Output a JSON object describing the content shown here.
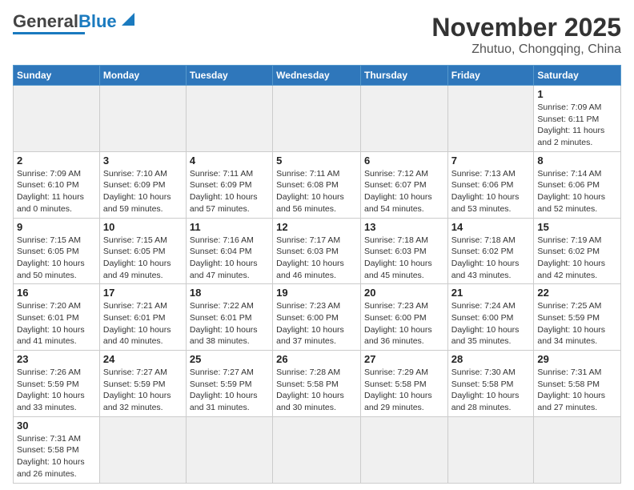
{
  "logo": {
    "text_general": "General",
    "text_blue": "Blue"
  },
  "title": {
    "month_year": "November 2025",
    "location": "Zhutuo, Chongqing, China"
  },
  "weekdays": [
    "Sunday",
    "Monday",
    "Tuesday",
    "Wednesday",
    "Thursday",
    "Friday",
    "Saturday"
  ],
  "weeks": [
    [
      {
        "day": "",
        "info": ""
      },
      {
        "day": "",
        "info": ""
      },
      {
        "day": "",
        "info": ""
      },
      {
        "day": "",
        "info": ""
      },
      {
        "day": "",
        "info": ""
      },
      {
        "day": "",
        "info": ""
      },
      {
        "day": "1",
        "info": "Sunrise: 7:09 AM\nSunset: 6:11 PM\nDaylight: 11 hours\nand 2 minutes."
      }
    ],
    [
      {
        "day": "2",
        "info": "Sunrise: 7:09 AM\nSunset: 6:10 PM\nDaylight: 11 hours\nand 0 minutes."
      },
      {
        "day": "3",
        "info": "Sunrise: 7:10 AM\nSunset: 6:09 PM\nDaylight: 10 hours\nand 59 minutes."
      },
      {
        "day": "4",
        "info": "Sunrise: 7:11 AM\nSunset: 6:09 PM\nDaylight: 10 hours\nand 57 minutes."
      },
      {
        "day": "5",
        "info": "Sunrise: 7:11 AM\nSunset: 6:08 PM\nDaylight: 10 hours\nand 56 minutes."
      },
      {
        "day": "6",
        "info": "Sunrise: 7:12 AM\nSunset: 6:07 PM\nDaylight: 10 hours\nand 54 minutes."
      },
      {
        "day": "7",
        "info": "Sunrise: 7:13 AM\nSunset: 6:06 PM\nDaylight: 10 hours\nand 53 minutes."
      },
      {
        "day": "8",
        "info": "Sunrise: 7:14 AM\nSunset: 6:06 PM\nDaylight: 10 hours\nand 52 minutes."
      }
    ],
    [
      {
        "day": "9",
        "info": "Sunrise: 7:15 AM\nSunset: 6:05 PM\nDaylight: 10 hours\nand 50 minutes."
      },
      {
        "day": "10",
        "info": "Sunrise: 7:15 AM\nSunset: 6:05 PM\nDaylight: 10 hours\nand 49 minutes."
      },
      {
        "day": "11",
        "info": "Sunrise: 7:16 AM\nSunset: 6:04 PM\nDaylight: 10 hours\nand 47 minutes."
      },
      {
        "day": "12",
        "info": "Sunrise: 7:17 AM\nSunset: 6:03 PM\nDaylight: 10 hours\nand 46 minutes."
      },
      {
        "day": "13",
        "info": "Sunrise: 7:18 AM\nSunset: 6:03 PM\nDaylight: 10 hours\nand 45 minutes."
      },
      {
        "day": "14",
        "info": "Sunrise: 7:18 AM\nSunset: 6:02 PM\nDaylight: 10 hours\nand 43 minutes."
      },
      {
        "day": "15",
        "info": "Sunrise: 7:19 AM\nSunset: 6:02 PM\nDaylight: 10 hours\nand 42 minutes."
      }
    ],
    [
      {
        "day": "16",
        "info": "Sunrise: 7:20 AM\nSunset: 6:01 PM\nDaylight: 10 hours\nand 41 minutes."
      },
      {
        "day": "17",
        "info": "Sunrise: 7:21 AM\nSunset: 6:01 PM\nDaylight: 10 hours\nand 40 minutes."
      },
      {
        "day": "18",
        "info": "Sunrise: 7:22 AM\nSunset: 6:01 PM\nDaylight: 10 hours\nand 38 minutes."
      },
      {
        "day": "19",
        "info": "Sunrise: 7:23 AM\nSunset: 6:00 PM\nDaylight: 10 hours\nand 37 minutes."
      },
      {
        "day": "20",
        "info": "Sunrise: 7:23 AM\nSunset: 6:00 PM\nDaylight: 10 hours\nand 36 minutes."
      },
      {
        "day": "21",
        "info": "Sunrise: 7:24 AM\nSunset: 6:00 PM\nDaylight: 10 hours\nand 35 minutes."
      },
      {
        "day": "22",
        "info": "Sunrise: 7:25 AM\nSunset: 5:59 PM\nDaylight: 10 hours\nand 34 minutes."
      }
    ],
    [
      {
        "day": "23",
        "info": "Sunrise: 7:26 AM\nSunset: 5:59 PM\nDaylight: 10 hours\nand 33 minutes."
      },
      {
        "day": "24",
        "info": "Sunrise: 7:27 AM\nSunset: 5:59 PM\nDaylight: 10 hours\nand 32 minutes."
      },
      {
        "day": "25",
        "info": "Sunrise: 7:27 AM\nSunset: 5:59 PM\nDaylight: 10 hours\nand 31 minutes."
      },
      {
        "day": "26",
        "info": "Sunrise: 7:28 AM\nSunset: 5:58 PM\nDaylight: 10 hours\nand 30 minutes."
      },
      {
        "day": "27",
        "info": "Sunrise: 7:29 AM\nSunset: 5:58 PM\nDaylight: 10 hours\nand 29 minutes."
      },
      {
        "day": "28",
        "info": "Sunrise: 7:30 AM\nSunset: 5:58 PM\nDaylight: 10 hours\nand 28 minutes."
      },
      {
        "day": "29",
        "info": "Sunrise: 7:31 AM\nSunset: 5:58 PM\nDaylight: 10 hours\nand 27 minutes."
      }
    ],
    [
      {
        "day": "30",
        "info": "Sunrise: 7:31 AM\nSunset: 5:58 PM\nDaylight: 10 hours\nand 26 minutes."
      },
      {
        "day": "",
        "info": ""
      },
      {
        "day": "",
        "info": ""
      },
      {
        "day": "",
        "info": ""
      },
      {
        "day": "",
        "info": ""
      },
      {
        "day": "",
        "info": ""
      },
      {
        "day": "",
        "info": ""
      }
    ]
  ]
}
